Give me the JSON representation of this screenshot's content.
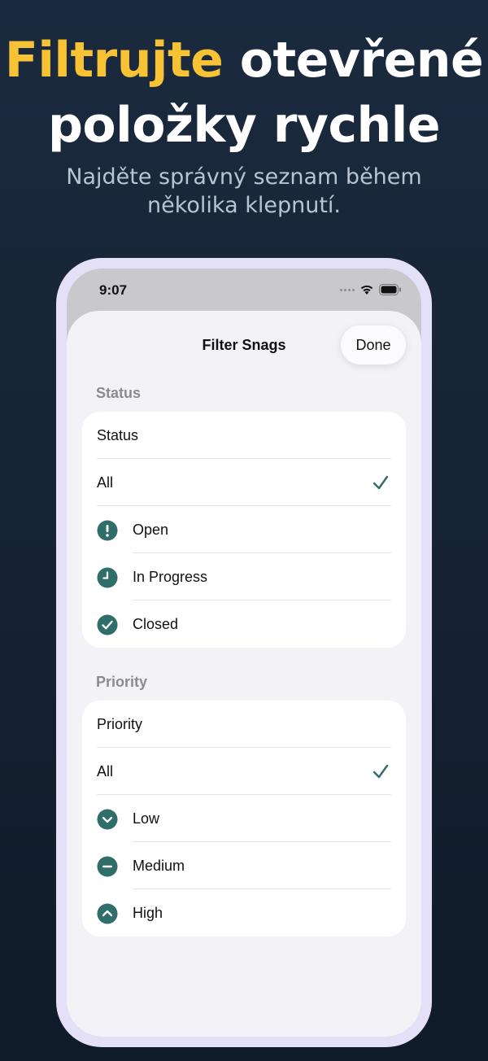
{
  "headline": {
    "accent": "Filtrujte",
    "rest": "otevřené položky rychle"
  },
  "subtitle": "Najděte správný seznam během několika klepnutí.",
  "status_bar": {
    "time": "9:07"
  },
  "sheet": {
    "title": "Filter Snags",
    "done_label": "Done",
    "status_section": {
      "header": "Status",
      "picker_label": "Status",
      "options": [
        {
          "label": "All",
          "selected": true
        },
        {
          "label": "Open",
          "icon": "exclamation-circle-icon"
        },
        {
          "label": "In Progress",
          "icon": "clock-icon"
        },
        {
          "label": "Closed",
          "icon": "checkmark-circle-icon"
        }
      ]
    },
    "priority_section": {
      "header": "Priority",
      "picker_label": "Priority",
      "options": [
        {
          "label": "All",
          "selected": true
        },
        {
          "label": "Low",
          "icon": "chevron-down-circle-icon"
        },
        {
          "label": "Medium",
          "icon": "minus-circle-icon"
        },
        {
          "label": "High",
          "icon": "chevron-up-circle-icon"
        }
      ]
    }
  },
  "colors": {
    "accent_yellow": "#f7c233",
    "teal": "#2f6e6a",
    "background": "#162232"
  }
}
